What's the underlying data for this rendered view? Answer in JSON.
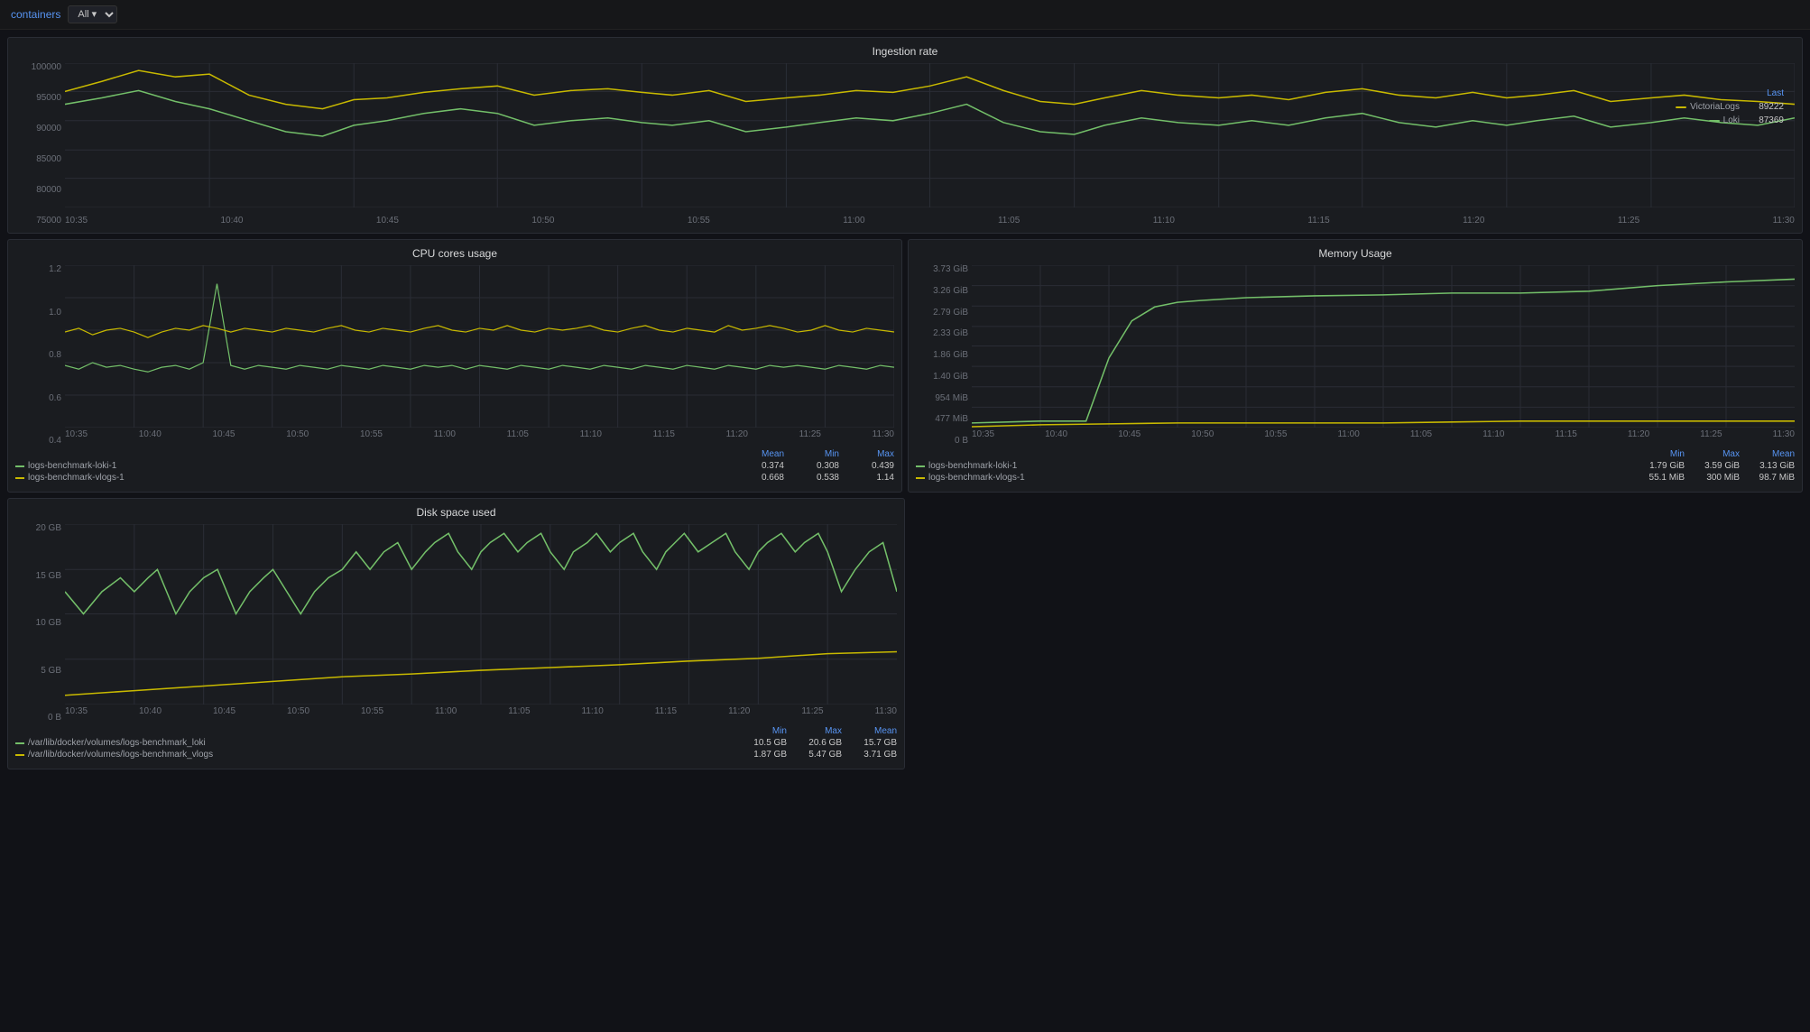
{
  "topbar": {
    "label": "containers",
    "select_value": "All",
    "select_options": [
      "All"
    ]
  },
  "ingestion_rate": {
    "title": "Ingestion rate",
    "y_labels": [
      "100000",
      "95000",
      "90000",
      "85000",
      "80000",
      "75000"
    ],
    "x_labels": [
      "10:35",
      "10:40",
      "10:45",
      "10:50",
      "10:55",
      "11:00",
      "11:05",
      "11:10",
      "11:15",
      "11:20",
      "11:25",
      "11:30"
    ],
    "legend_header": "Last",
    "legend": [
      {
        "name": "VictoriaLogs",
        "color": "#c8b900",
        "value": "89222"
      },
      {
        "name": "Loki",
        "color": "#73bf69",
        "value": "87369"
      }
    ]
  },
  "cpu_usage": {
    "title": "CPU cores usage",
    "y_labels": [
      "1.2",
      "1.0",
      "0.8",
      "0.6",
      "0.4"
    ],
    "x_labels": [
      "10:35",
      "10:40",
      "10:45",
      "10:50",
      "10:55",
      "11:00",
      "11:05",
      "11:10",
      "11:15",
      "11:20",
      "11:25",
      "11:30"
    ],
    "stat_headers": [
      "Mean",
      "Min",
      "Max"
    ],
    "stats": [
      {
        "name": "logs-benchmark-loki-1",
        "color": "#73bf69",
        "mean": "0.374",
        "min": "0.308",
        "max": "0.439"
      },
      {
        "name": "logs-benchmark-vlogs-1",
        "color": "#c8b900",
        "mean": "0.668",
        "min": "0.538",
        "max": "1.14"
      }
    ]
  },
  "memory_usage": {
    "title": "Memory Usage",
    "y_labels": [
      "3.73 GiB",
      "3.26 GiB",
      "2.79 GiB",
      "2.33 GiB",
      "1.86 GiB",
      "1.40 GiB",
      "954 MiB",
      "477 MiB",
      "0 B"
    ],
    "x_labels": [
      "10:35",
      "10:40",
      "10:45",
      "10:50",
      "10:55",
      "11:00",
      "11:05",
      "11:10",
      "11:15",
      "11:20",
      "11:25",
      "11:30"
    ],
    "stat_headers": [
      "Min",
      "Max",
      "Mean"
    ],
    "stats": [
      {
        "name": "logs-benchmark-loki-1",
        "color": "#73bf69",
        "min": "1.79 GiB",
        "max": "3.59 GiB",
        "mean": "3.13 GiB"
      },
      {
        "name": "logs-benchmark-vlogs-1",
        "color": "#c8b900",
        "min": "55.1 MiB",
        "max": "300 MiB",
        "mean": "98.7 MiB"
      }
    ]
  },
  "disk_space": {
    "title": "Disk space used",
    "y_labels": [
      "20 GB",
      "15 GB",
      "10 GB",
      "5 GB",
      "0 B"
    ],
    "x_labels": [
      "10:35",
      "10:40",
      "10:45",
      "10:50",
      "10:55",
      "11:00",
      "11:05",
      "11:10",
      "11:15",
      "11:20",
      "11:25",
      "11:30"
    ],
    "stat_headers": [
      "Min",
      "Max",
      "Mean"
    ],
    "stats": [
      {
        "name": "/var/lib/docker/volumes/logs-benchmark_loki",
        "color": "#73bf69",
        "min": "10.5 GB",
        "max": "20.6 GB",
        "mean": "15.7 GB"
      },
      {
        "name": "/var/lib/docker/volumes/logs-benchmark_vlogs",
        "color": "#c8b900",
        "min": "1.87 GB",
        "max": "5.47 GB",
        "mean": "3.71 GB"
      }
    ]
  }
}
